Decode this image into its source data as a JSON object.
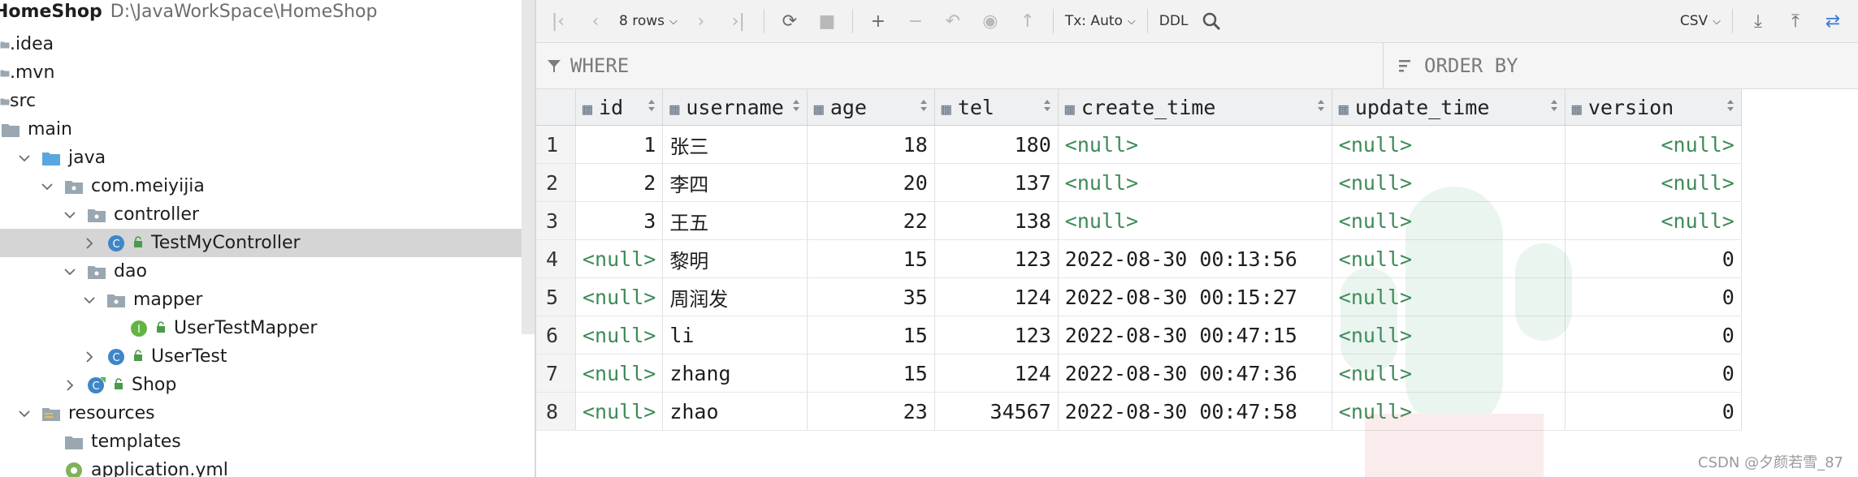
{
  "project_tree": {
    "project_name": "HomeShop",
    "project_path": "D:\\JavaWorkSpace\\HomeShop",
    "items": [
      {
        "label": "HomeShop",
        "icon": "project-folder-icon"
      },
      {
        "label": ".idea",
        "icon": "folder-icon"
      },
      {
        "label": ".mvn",
        "icon": "folder-icon"
      },
      {
        "label": "src",
        "icon": "folder-icon"
      },
      {
        "label": "main",
        "icon": "folder-icon"
      },
      {
        "label": "java",
        "icon": "source-folder-icon"
      },
      {
        "label": "com.meiyijia",
        "icon": "package-icon"
      },
      {
        "label": "controller",
        "icon": "package-icon"
      },
      {
        "label": "TestMyController",
        "icon": "class-icon"
      },
      {
        "label": "dao",
        "icon": "package-icon"
      },
      {
        "label": "mapper",
        "icon": "package-icon"
      },
      {
        "label": "UserTestMapper",
        "icon": "interface-icon"
      },
      {
        "label": "UserTest",
        "icon": "class-icon"
      },
      {
        "label": "Shop",
        "icon": "spring-class-icon"
      },
      {
        "label": "resources",
        "icon": "resources-folder-icon"
      },
      {
        "label": "templates",
        "icon": "folder-icon"
      },
      {
        "label": "application.yml",
        "icon": "yaml-icon"
      }
    ],
    "selected": "TestMyController"
  },
  "toolbar": {
    "rows_label": "8 rows",
    "tx_label": "Tx: Auto",
    "ddl_label": "DDL",
    "export_label": "CSV"
  },
  "filter": {
    "where_label": "WHERE",
    "order_by_label": "ORDER BY"
  },
  "table": {
    "columns": [
      "id",
      "username",
      "age",
      "tel",
      "create_time",
      "update_time",
      "version"
    ],
    "rows": [
      [
        "1",
        "1",
        "张三",
        "18",
        "180",
        "<null>",
        "<null>",
        "<null>"
      ],
      [
        "2",
        "2",
        "李四",
        "20",
        "137",
        "<null>",
        "<null>",
        "<null>"
      ],
      [
        "3",
        "3",
        "王五",
        "22",
        "138",
        "<null>",
        "<null>",
        "<null>"
      ],
      [
        "4",
        "<null>",
        "黎明",
        "15",
        "123",
        "2022-08-30 00:13:56",
        "<null>",
        "0"
      ],
      [
        "5",
        "<null>",
        "周润发",
        "35",
        "124",
        "2022-08-30 00:15:27",
        "<null>",
        "0"
      ],
      [
        "6",
        "<null>",
        "li",
        "15",
        "123",
        "2022-08-30 00:47:15",
        "<null>",
        "0"
      ],
      [
        "7",
        "<null>",
        "zhang",
        "15",
        "124",
        "2022-08-30 00:47:36",
        "<null>",
        "0"
      ],
      [
        "8",
        "<null>",
        "zhao",
        "23",
        "34567",
        "2022-08-30 00:47:58",
        "<null>",
        "0"
      ]
    ]
  },
  "watermark": "CSDN @夕颜若雪_87",
  "colors": {
    "null_value": "#3d8a57",
    "selection": "#d5d5d5",
    "folder": "#9aa7b1",
    "java_folder": "#5aa7e0"
  }
}
